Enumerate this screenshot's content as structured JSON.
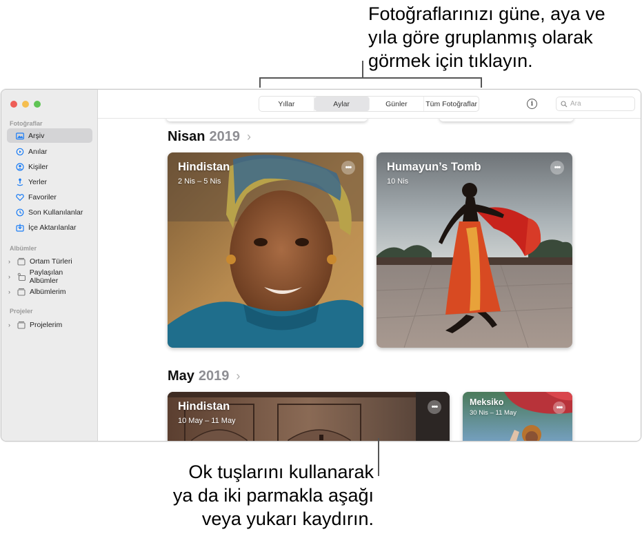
{
  "callouts": {
    "top": [
      "Fotoğraflarınızı güne, aya ve",
      "yıla göre gruplanmış olarak",
      "görmek için tıklayın."
    ],
    "bottom": [
      "Ok tuşlarını kullanarak",
      "ya da iki parmakla aşağı",
      "veya yukarı kaydırın."
    ]
  },
  "sidebar": {
    "sections": {
      "photos": "Fotoğraflar",
      "albums": "Albümler",
      "projects": "Projeler"
    },
    "library_items": [
      {
        "label": "Arşiv",
        "icon": "library-icon",
        "selected": true
      },
      {
        "label": "Anılar",
        "icon": "memories-icon"
      },
      {
        "label": "Kişiler",
        "icon": "people-icon"
      },
      {
        "label": "Yerler",
        "icon": "places-icon"
      },
      {
        "label": "Favoriler",
        "icon": "heart-icon"
      },
      {
        "label": "Son Kullanılanlar",
        "icon": "clock-icon"
      },
      {
        "label": "İçe Aktarılanlar",
        "icon": "import-icon"
      }
    ],
    "album_items": [
      {
        "label": "Ortam Türleri",
        "icon": "folder-icon"
      },
      {
        "label": "Paylaşılan Albümler",
        "icon": "shared-albums-icon"
      },
      {
        "label": "Albümlerim",
        "icon": "folder-icon"
      }
    ],
    "project_items": [
      {
        "label": "Projelerim",
        "icon": "folder-icon"
      }
    ]
  },
  "toolbar": {
    "tabs": [
      "Yıllar",
      "Aylar",
      "Günler",
      "Tüm Fotoğraflar"
    ],
    "active_tab": "Aylar",
    "search_placeholder": "Ara"
  },
  "groups": [
    {
      "month": "Nisan",
      "year": "2019",
      "cards": [
        {
          "title": "Hindistan",
          "subtitle": "2 Nis – 5 Nis"
        },
        {
          "title": "Humayun’s Tomb",
          "subtitle": "10 Nis"
        }
      ]
    },
    {
      "month": "May",
      "year": "2019",
      "cards": [
        {
          "title": "Hindistan",
          "subtitle": "10 May – 11 May"
        },
        {
          "title": "Meksiko",
          "subtitle": "30 Nis – 11 May"
        }
      ]
    }
  ],
  "colors": {
    "accent": "#1a7cf5",
    "sidebar_bg": "#ececec",
    "selected_bg": "#d4d4d6"
  }
}
